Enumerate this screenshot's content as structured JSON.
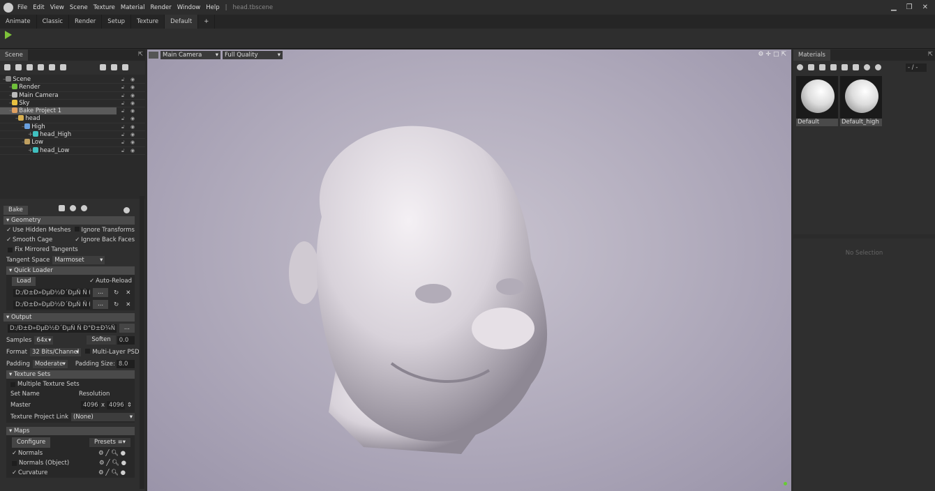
{
  "menu": {
    "items": [
      "File",
      "Edit",
      "View",
      "Scene",
      "Texture",
      "Material",
      "Render",
      "Window",
      "Help"
    ],
    "document": "head.tbscene"
  },
  "tabs": [
    "Animate",
    "Classic",
    "Render",
    "Setup",
    "Texture",
    "Default",
    "+"
  ],
  "scene": {
    "tab": "Scene",
    "tree": [
      {
        "label": "Scene",
        "indent": 0,
        "color": "#888"
      },
      {
        "label": "Render",
        "indent": 1,
        "color": "#6fc03a"
      },
      {
        "label": "Main Camera",
        "indent": 1,
        "color": "#bbb"
      },
      {
        "label": "Sky",
        "indent": 1,
        "color": "#e8c040"
      },
      {
        "label": "Bake Project 1",
        "indent": 1,
        "color": "#e0a060"
      },
      {
        "label": "head",
        "indent": 2,
        "color": "#d8b050"
      },
      {
        "label": "High",
        "indent": 3,
        "color": "#6aa0e0"
      },
      {
        "label": "head_High",
        "indent": 4,
        "color": "#40c0c0"
      },
      {
        "label": "Low",
        "indent": 3,
        "color": "#c0a060"
      },
      {
        "label": "head_Low",
        "indent": 4,
        "color": "#40c0c0"
      }
    ]
  },
  "bake": {
    "bake_label": "Bake",
    "geometry": "Geometry",
    "use_hidden": "Use Hidden Meshes",
    "ignore_transforms": "Ignore Transforms",
    "smooth_cage": "Smooth Cage",
    "ignore_back": "Ignore Back Faces",
    "fix_mirrored": "Fix Mirrored Tangents",
    "tangent_label": "Tangent Space",
    "tangent_value": "Marmoset",
    "quick_loader": "Quick Loader",
    "load": "Load",
    "auto_reload": "Auto-Reload",
    "path1": "D:/Ð±Ð»ÐµÐ½Ð´ÐµÑ  Ñ  Ð°",
    "path2": "D:/Ð±Ð»ÐµÐ½Ð´ÐµÑ  Ñ  Ð°",
    "browse": "...",
    "output": "Output",
    "output_path": "D:/Ð±Ð»ÐµÐ½Ð´ÐµÑ  Ñ  Ð°Ð±Ð¾Ñ  Ñ",
    "samples_label": "Samples",
    "samples": "64x",
    "soften_label": "Soften",
    "soften": "0.0",
    "format_label": "Format",
    "format": "32 Bits/Channel",
    "multilayer": "Multi-Layer PSD",
    "padding_label": "Padding",
    "padding": "Moderate",
    "padding_size_label": "Padding Size:",
    "padding_size": "8.0",
    "texture_sets": "Texture Sets",
    "multiple_sets": "Multiple Texture Sets",
    "set_name": "Set Name",
    "resolution": "Resolution",
    "master": "Master",
    "res_w": "4096",
    "x": "x",
    "res_h": "4096",
    "project_link_label": "Texture Project Link",
    "project_link": "(None)",
    "maps": "Maps",
    "configure": "Configure",
    "presets": "Presets",
    "map_items": [
      "Normals",
      "Normals (Object)",
      "Curvature"
    ]
  },
  "viewport": {
    "camera": "Main Camera",
    "quality": "Full Quality"
  },
  "materials": {
    "tab": "Materials",
    "counter": "- / -",
    "items": [
      "Default",
      "Default_high"
    ],
    "no_selection": "No Selection"
  }
}
